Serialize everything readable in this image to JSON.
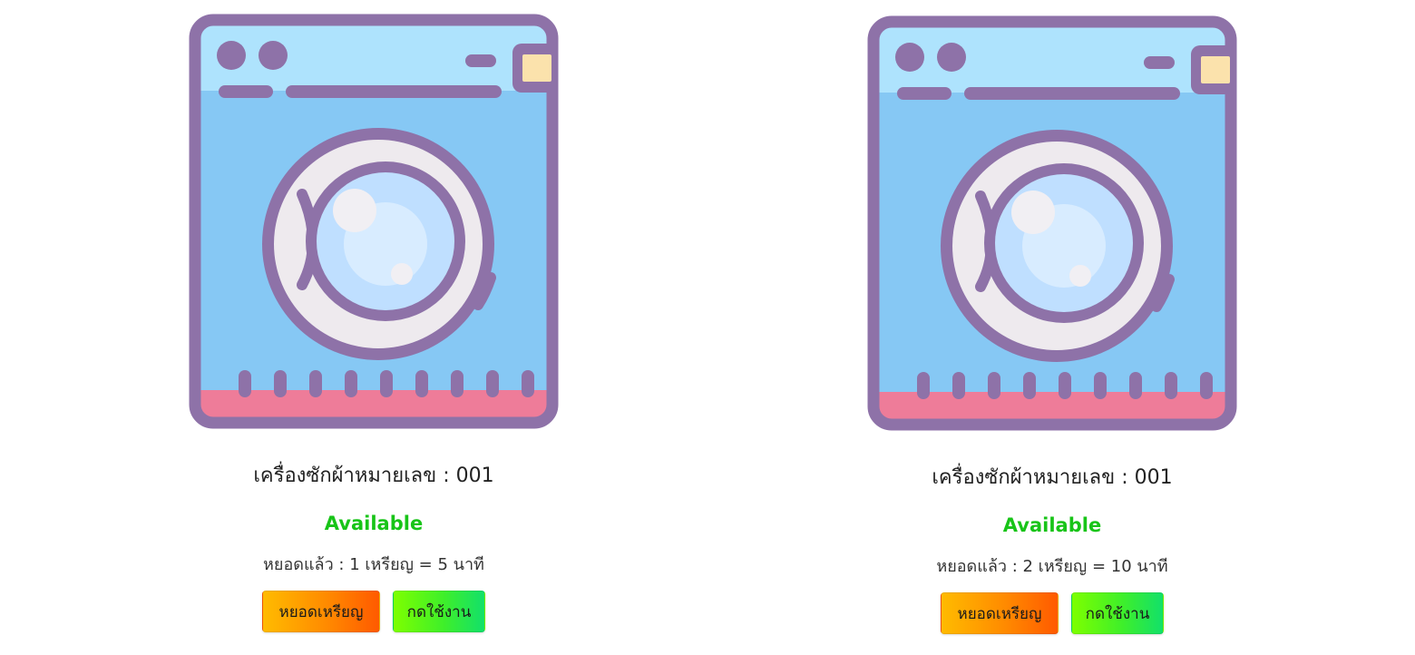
{
  "machines": [
    {
      "title": "เครื่องซักผ้าหมายเลข : 001",
      "status": "Available",
      "coin_info": "หยอดแล้ว : 1 เหรียญ = 5 นาที",
      "insert_coin_label": "หยอดเหรียญ",
      "start_label": "กดใช้งาน"
    },
    {
      "title": "เครื่องซักผ้าหมายเลข : 001",
      "status": "Available",
      "coin_info": "หยอดแล้ว : 2 เหรียญ = 10 นาที",
      "insert_coin_label": "หยอดเหรียญ",
      "start_label": "กดใช้งาน"
    }
  ],
  "colors": {
    "status_available": "#18c418",
    "machine_outline": "#8e72a8",
    "machine_body": "#86c8f4",
    "machine_panel": "#aee3fd",
    "machine_base": "#ee7c99",
    "coin_button": "#ff8a00",
    "start_button": "#3fef2a"
  },
  "icons": {
    "machine": "washing-machine-icon"
  }
}
